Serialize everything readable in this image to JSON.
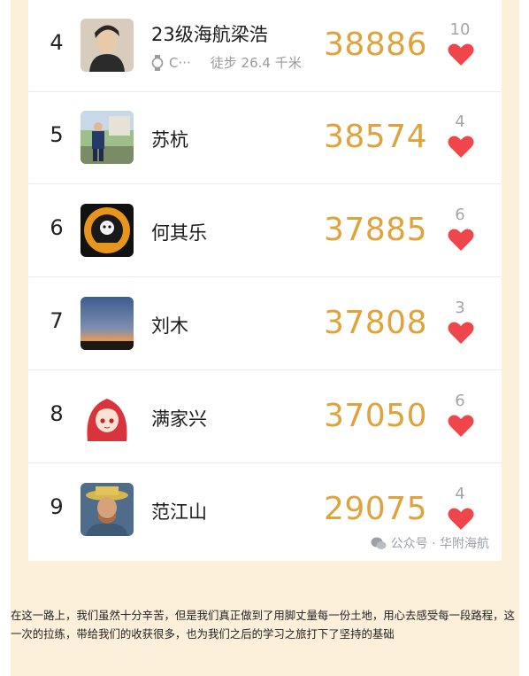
{
  "ranking": [
    {
      "rank": "4",
      "name": "23级海航梁浩",
      "device": "C···",
      "steps_label": "徒步 26.4 千米",
      "score": "38886",
      "likes": "10",
      "avatar_icon": "person-portrait-icon"
    },
    {
      "rank": "5",
      "name": "苏杭",
      "score": "38574",
      "likes": "4",
      "avatar_icon": "person-outdoor-photo-icon"
    },
    {
      "rank": "6",
      "name": "何其乐",
      "score": "37885",
      "likes": "6",
      "avatar_icon": "fighting-cat-logo-icon"
    },
    {
      "rank": "7",
      "name": "刘木",
      "score": "37808",
      "likes": "3",
      "avatar_icon": "sunset-landscape-icon"
    },
    {
      "rank": "8",
      "name": "满家兴",
      "score": "37050",
      "likes": "6",
      "avatar_icon": "anime-girl-icon"
    },
    {
      "rank": "9",
      "name": "范江山",
      "score": "29075",
      "likes": "4",
      "avatar_icon": "van-gogh-portrait-icon"
    }
  ],
  "watermark": {
    "text": "公众号 · 华附海航"
  },
  "caption": "在这一路上，我们虽然十分辛苦，但是我们真正做到了用脚丈量每一份土地，用心去感受每一段路程，这一次的拉练，带给我们的收获很多，也为我们之后的学习之旅打下了坚持的基础",
  "colors": {
    "score": "#e0a33b",
    "heart": "#f0454b",
    "background": "#fdf0db"
  }
}
